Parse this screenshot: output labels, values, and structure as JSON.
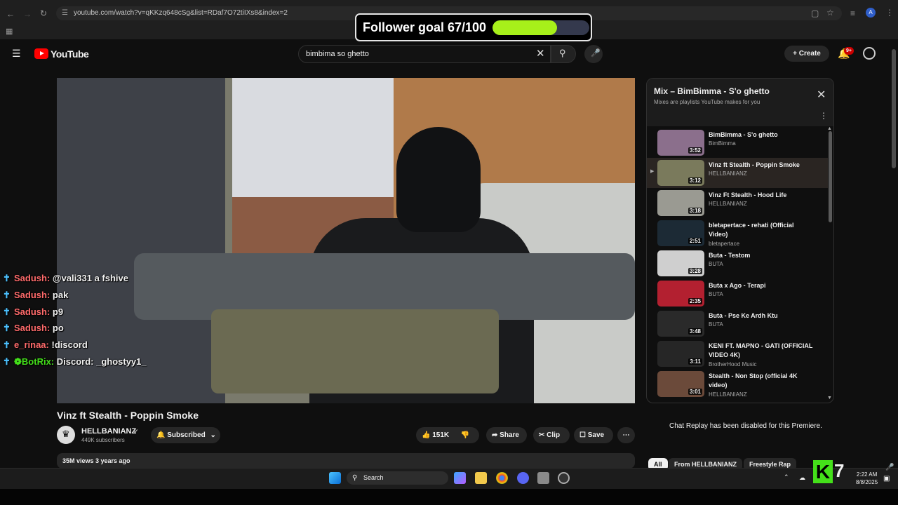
{
  "browser": {
    "url": "youtube.com/watch?v=qKKzq648cSg&list=RDaf7O72tiIXs8&index=2"
  },
  "overlay": {
    "goal_label": "Follower goal 67/100",
    "goal_fraction": 0.67,
    "goal_color": "#a7f01a"
  },
  "header": {
    "logo_text": "YouTube",
    "search_value": "bimbima so ghetto",
    "create_label": "+ Create",
    "notification_badge": "9+",
    "avatar_letter": "A"
  },
  "chat": {
    "messages": [
      {
        "user": "Sadush:",
        "text": "@vali331 a fshive"
      },
      {
        "user": "Sadush:",
        "text": "pak"
      },
      {
        "user": "Sadush:",
        "text": "p9"
      },
      {
        "user": "Sadush:",
        "text": "po"
      },
      {
        "user": "e_rinaa:",
        "text": "!discord"
      },
      {
        "user": "BotRix:",
        "text": "Discord: _ghostyy1_"
      }
    ]
  },
  "video": {
    "title": "Vinz ft Stealth - Poppin Smoke",
    "channel": "HELLBANIANZ",
    "subscribers": "449K subscribers",
    "subscribed_label": "Subscribed",
    "likes": "151K",
    "share_label": "Share",
    "clip_label": "Clip",
    "save_label": "Save",
    "views_date": "35M views  3 years ago"
  },
  "playlist": {
    "title": "Mix – BimBimma - S'o ghetto",
    "subtitle": "Mixes are playlists YouTube makes for you",
    "items": [
      {
        "title": "BimBimma - S'o ghetto",
        "channel": "BimBimma",
        "duration": "3:52",
        "thumb": "#8b6f8c"
      },
      {
        "title": "Vinz ft Stealth - Poppin Smoke",
        "channel": "HELLBANIANZ",
        "duration": "3:12",
        "thumb": "#7a7a5c"
      },
      {
        "title": "Vinz Ft Stealth - Hood Life",
        "channel": "HELLBANIANZ",
        "duration": "3:18",
        "thumb": "#9a9a92"
      },
      {
        "title": "bletapertace - rehati (Official Video)",
        "channel": "bletapertace",
        "duration": "2:51",
        "thumb": "#1c2a35"
      },
      {
        "title": "Buta - Testom",
        "channel": "BUTA",
        "duration": "3:28",
        "thumb": "#cfcfcf"
      },
      {
        "title": "Buta x Ago - Terapi",
        "channel": "BUTA",
        "duration": "2:35",
        "thumb": "#b32030"
      },
      {
        "title": "Buta - Pse Ke Ardh Ktu",
        "channel": "BUTA",
        "duration": "3:48",
        "thumb": "#2a2a2a"
      },
      {
        "title": "KENI FT. MAPNO - GATI (OFFICIAL VIDEO 4K)",
        "channel": "BrotherHood Music",
        "duration": "3:11",
        "thumb": "#262626"
      },
      {
        "title": "Stealth - Non Stop (official 4K video)",
        "channel": "HELLBANIANZ",
        "duration": "3:01",
        "thumb": "#6b4a3a"
      }
    ]
  },
  "side": {
    "chat_replay_note": "Chat Replay has been disabled for this Premiere.",
    "chips": [
      "All",
      "From HELLBANIANZ",
      "Freestyle Rap"
    ]
  },
  "taskbar": {
    "search_label": "Search",
    "time": "2:22 AM",
    "date": "8/8/2025",
    "k_badge_number": "7"
  }
}
